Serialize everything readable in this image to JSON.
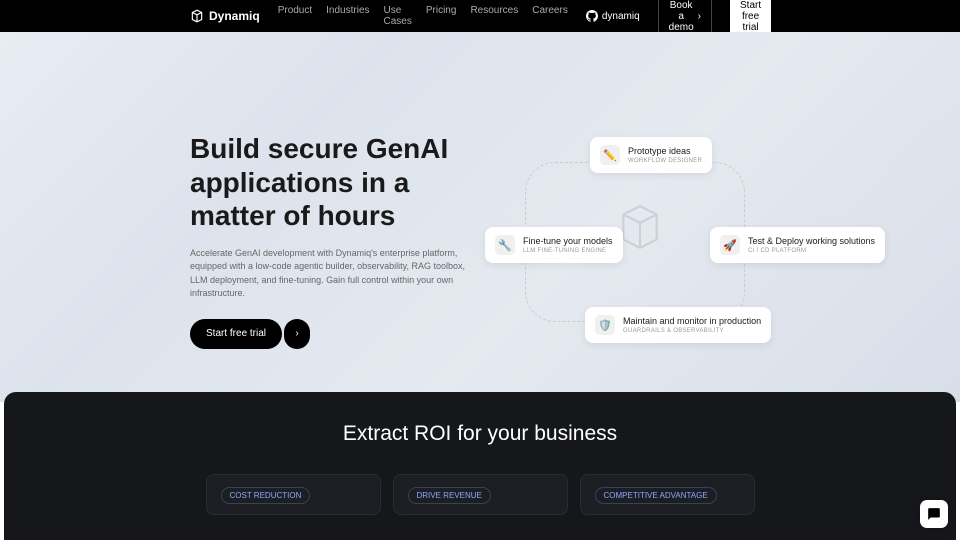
{
  "brand": "Dynamiq",
  "nav": {
    "items": [
      "Product",
      "Industries",
      "Use Cases",
      "Pricing",
      "Resources",
      "Careers"
    ],
    "github": "dynamiq",
    "book_demo": "Book a demo",
    "start_trial": "Start free trial"
  },
  "hero": {
    "title": "Build secure GenAI applications in a matter of hours",
    "description": "Accelerate GenAI development with Dynamiq's enterprise platform, equipped with a low-code agentic builder, observability, RAG toolbox, LLM deployment, and fine-tuning. Gain full control within your own infrastructure.",
    "cta": "Start free trial"
  },
  "features": [
    {
      "title": "Prototype ideas",
      "sub": "WORKFLOW DESIGNER",
      "icon": "✏️"
    },
    {
      "title": "Fine-tune your models",
      "sub": "LLM FINE-TUNING ENGINE",
      "icon": "🔧"
    },
    {
      "title": "Test & Deploy working solutions",
      "sub": "CI / CD PLATFORM",
      "icon": "🚀"
    },
    {
      "title": "Maintain and monitor in production",
      "sub": "GUARDRAILS & OBSERVABILITY",
      "icon": "🛡️"
    }
  ],
  "roi": {
    "title": "Extract ROI for your business",
    "badges": [
      "COST REDUCTION",
      "DRIVE REVENUE",
      "COMPETITIVE ADVANTAGE"
    ]
  }
}
